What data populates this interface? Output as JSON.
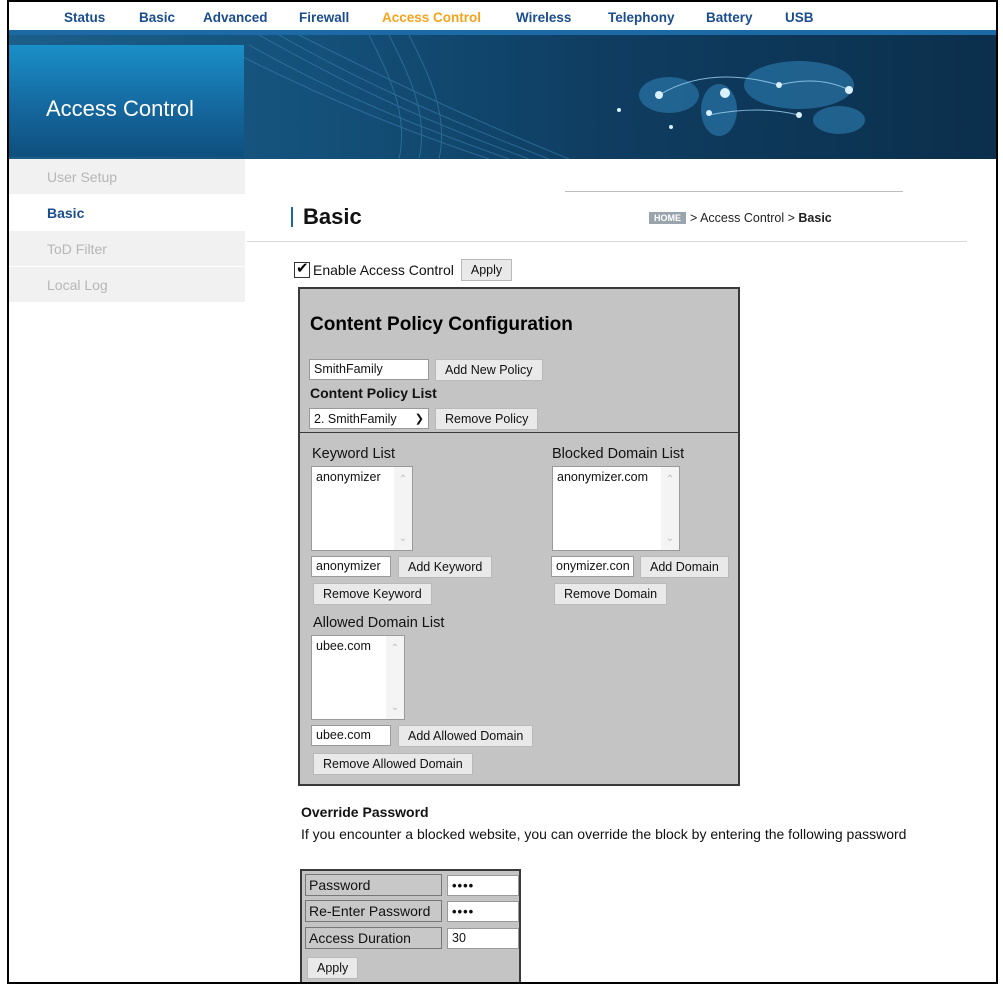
{
  "topnav": [
    "Status",
    "Basic",
    "Advanced",
    "Firewall",
    "Access Control",
    "Wireless",
    "Telephony",
    "Battery",
    "USB"
  ],
  "banner": {
    "title": "Access Control"
  },
  "sidebar": [
    "User Setup",
    "Basic",
    "ToD Filter",
    "Local Log"
  ],
  "page": {
    "title": "Basic",
    "breadcrumb": {
      "home": "HOME",
      "trail": "> Access Control > ",
      "current": "Basic"
    }
  },
  "enable": {
    "label": "Enable Access Control",
    "checked": true,
    "apply": "Apply"
  },
  "content_policy": {
    "title": "Content Policy Configuration",
    "new_policy_value": "SmithFamily",
    "add_new_policy": "Add New Policy",
    "list_label": "Content Policy List",
    "selected_policy": "2. SmithFamily",
    "remove_policy": "Remove Policy"
  },
  "keyword": {
    "label": "Keyword List",
    "items": [
      "anonymizer"
    ],
    "input_value": "anonymizer",
    "add": "Add Keyword",
    "remove": "Remove Keyword"
  },
  "blocked": {
    "label": "Blocked Domain List",
    "items": [
      "anonymizer.com"
    ],
    "input_value": "onymizer.con",
    "add": "Add Domain",
    "remove": "Remove Domain"
  },
  "allowed": {
    "label": "Allowed Domain List",
    "items": [
      "ubee.com"
    ],
    "input_value": "ubee.com",
    "add": "Add Allowed Domain",
    "remove": "Remove Allowed Domain"
  },
  "override": {
    "title": "Override Password",
    "description": "If you encounter a blocked website, you can override the block by entering the following password",
    "password_label": "Password",
    "password_value": "••••",
    "reenter_label": "Re-Enter Password",
    "reenter_value": "••••",
    "duration_label": "Access Duration",
    "duration_value": "30",
    "apply": "Apply"
  },
  "colors": {
    "nav_text": "#1a4d8f",
    "nav_active": "#f5a31a",
    "banner": "#14517a",
    "panel": "#c4c4c4"
  }
}
